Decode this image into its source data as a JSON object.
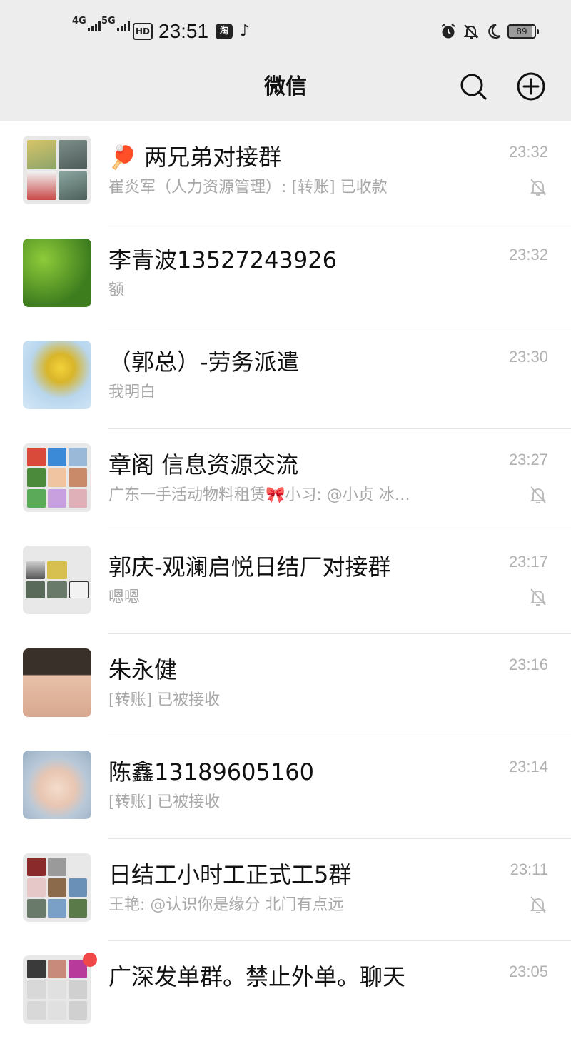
{
  "status_bar": {
    "signal1": "4G",
    "signal2": "5G",
    "hd": "HD",
    "clock": "23:51",
    "app_icon": "淘",
    "tiktok": "♪",
    "battery": "89"
  },
  "header": {
    "title": "微信"
  },
  "chats": [
    {
      "emoji": "🏓",
      "name": "两兄弟对接群",
      "message": "崔炎军（人力资源管理）: [转账] 已收款",
      "time": "23:32",
      "muted": true,
      "avatar": "group-grid-3"
    },
    {
      "emoji": "",
      "name": "李青波13527243926",
      "message": "额",
      "time": "23:32",
      "muted": false,
      "avatar": "green-bushes"
    },
    {
      "emoji": "",
      "name": "（郭总）-劳务派遣",
      "message": "我明白",
      "time": "23:30",
      "muted": false,
      "avatar": "yellow-flowers"
    },
    {
      "emoji": "",
      "name": "章阁 信息资源交流",
      "message": "广东一手活动物料租赁🎀小习: @小贞 冰…",
      "time": "23:27",
      "muted": true,
      "avatar": "group-grid-9"
    },
    {
      "emoji": "",
      "name": "郭庆-观澜启悦日结厂对接群",
      "message": "嗯嗯",
      "time": "23:17",
      "muted": true,
      "avatar": "group-grid-5"
    },
    {
      "emoji": "",
      "name": "朱永健",
      "message": "[转账] 已被接收",
      "time": "23:16",
      "muted": false,
      "avatar": "man-face"
    },
    {
      "emoji": "",
      "name": "陈鑫13189605160",
      "message": "[转账] 已被接收",
      "time": "23:14",
      "muted": false,
      "avatar": "man-sunglasses"
    },
    {
      "emoji": "",
      "name": "日结工小时工正式工5群",
      "message": "王艳: @认识你是缘分 北门有点远",
      "time": "23:11",
      "muted": true,
      "avatar": "group-grid-9b"
    },
    {
      "emoji": "",
      "name": "广深发单群。禁止外单。聊天",
      "message": "",
      "time": "23:05",
      "muted": false,
      "avatar": "group-grid-9c"
    }
  ],
  "colors": {
    "header_bg": "#ededed",
    "name_text": "#111111",
    "preview_text": "#a8a8a8",
    "time_text": "#b0b0b0",
    "badge": "#f04848"
  },
  "icons": [
    "search-icon",
    "add-circle-icon",
    "mute-bell-icon",
    "alarm-icon",
    "bell-off-icon",
    "moon-icon",
    "tiktok-icon",
    "taobao-icon"
  ]
}
